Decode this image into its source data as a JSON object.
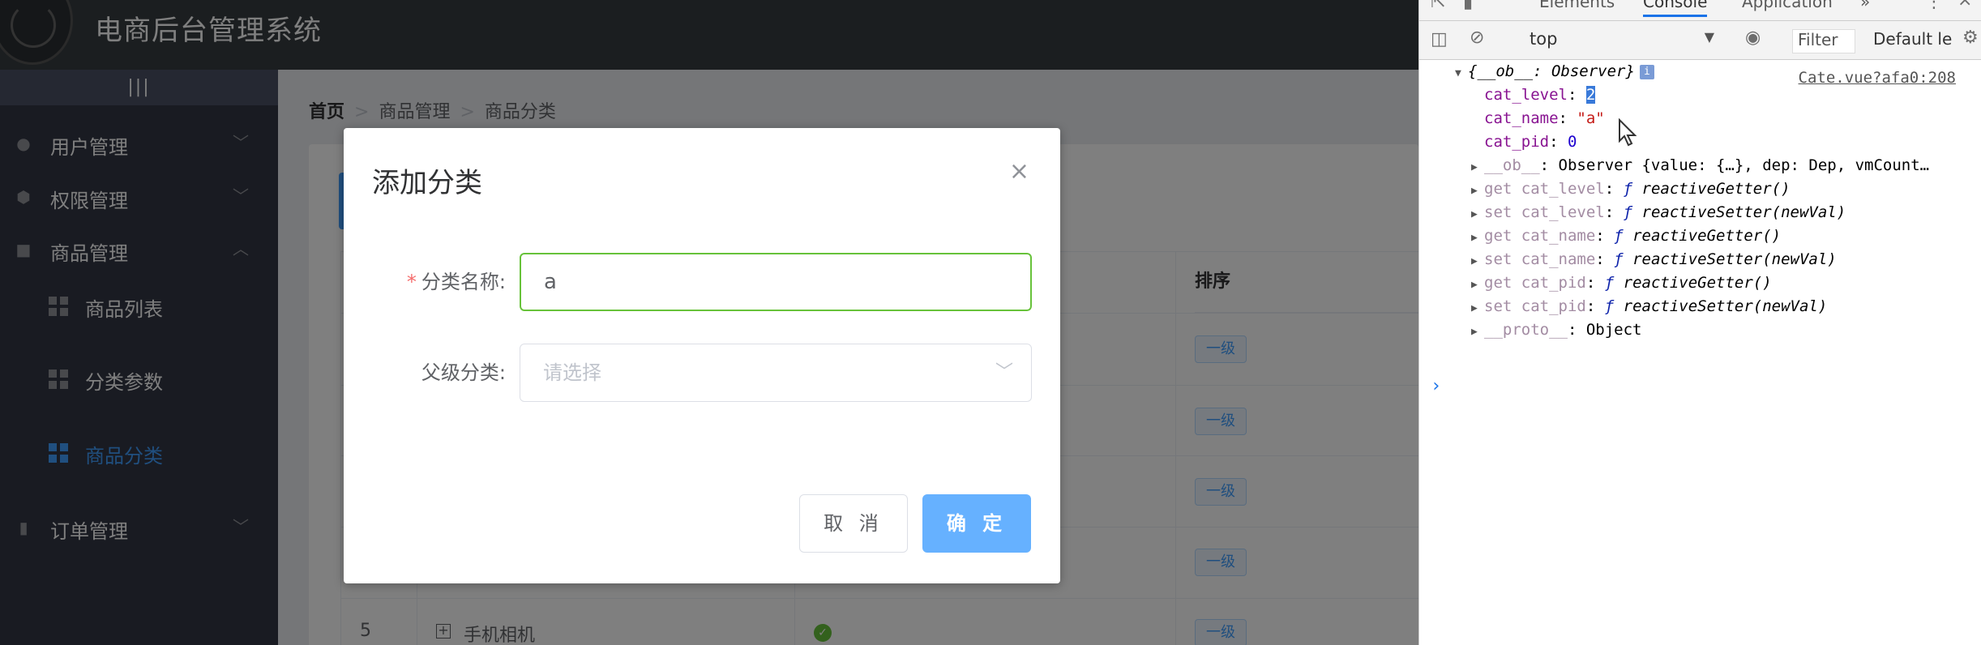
{
  "app": {
    "title": "电商后台管理系统",
    "collapse_toggle": "|||",
    "menu": [
      {
        "label": "用户管理",
        "icon": "user-icon",
        "arrow": "﹀"
      },
      {
        "label": "权限管理",
        "icon": "cube-icon",
        "arrow": "﹀"
      },
      {
        "label": "商品管理",
        "icon": "bag-icon",
        "arrow": "︿"
      },
      {
        "label": "订单管理",
        "icon": "clipboard-icon",
        "arrow": "﹀"
      }
    ],
    "submenu": [
      {
        "label": "商品列表",
        "icon": "grid-icon"
      },
      {
        "label": "分类参数",
        "icon": "grid-icon"
      },
      {
        "label": "商品分类",
        "icon": "grid-icon",
        "active": true
      }
    ],
    "breadcrumb": [
      "首页",
      "商品管理",
      "商品分类"
    ],
    "breadcrumb_sep": ">",
    "table": {
      "col_sort": "排序",
      "tags": [
        "一级",
        "一级",
        "一级",
        "一级",
        "一级"
      ],
      "row5": {
        "index": "5",
        "name": "手机相机",
        "expand": "+"
      }
    }
  },
  "dialog": {
    "title": "添加分类",
    "close": "×",
    "fields": {
      "cat_name": {
        "label": "分类名称:",
        "required_mark": "*",
        "value": "a"
      },
      "parent": {
        "label": "父级分类:",
        "placeholder": "请选择",
        "arrow": "﹀"
      }
    },
    "cancel_label": "取 消",
    "ok_label": "确 定"
  },
  "devtools": {
    "tabs": [
      "Elements",
      "Console",
      "Application",
      "»"
    ],
    "active_tab": "Console",
    "context": "top",
    "filter_placeholder": "Filter",
    "levels_label": "Default le",
    "source_link": "Cate.vue?afa0:208",
    "log": {
      "header_open": "{__ob__: Observer}",
      "info": "i",
      "props": [
        {
          "key": "cat_level",
          "value": "2",
          "value_type": "num",
          "selected": true
        },
        {
          "key": "cat_name",
          "value": "\"a\"",
          "value_type": "str"
        },
        {
          "key": "cat_pid",
          "value": "0",
          "value_type": "num"
        }
      ],
      "collapsed": [
        {
          "key": "__ob__",
          "value": "Observer {value: {…}, dep: Dep, vmCount…",
          "kind": "plain"
        },
        {
          "key": "get cat_level",
          "value": "reactiveGetter()",
          "kind": "fn"
        },
        {
          "key": "set cat_level",
          "value": "reactiveSetter(newVal)",
          "kind": "fn"
        },
        {
          "key": "get cat_name",
          "value": "reactiveGetter()",
          "kind": "fn"
        },
        {
          "key": "set cat_name",
          "value": "reactiveSetter(newVal)",
          "kind": "fn"
        },
        {
          "key": "get cat_pid",
          "value": "reactiveGetter()",
          "kind": "fn"
        },
        {
          "key": "set cat_pid",
          "value": "reactiveSetter(newVal)",
          "kind": "fn"
        },
        {
          "key": "__proto__",
          "value": "Object",
          "kind": "plain"
        }
      ],
      "prompt": "›"
    }
  }
}
